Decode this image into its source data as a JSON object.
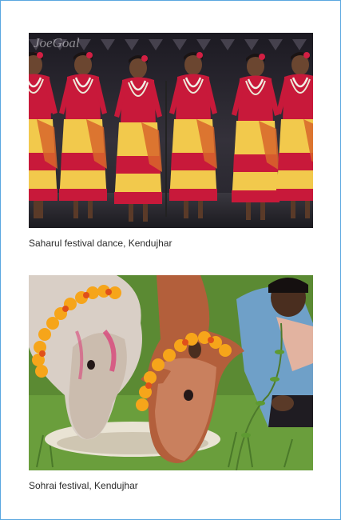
{
  "figures": [
    {
      "caption": "Saharul festival dance, Kendujhar",
      "watermark": "JoeGoal"
    },
    {
      "caption": "Sohrai festival, Kendujhar"
    }
  ],
  "colors": {
    "frame_border": "#5aa7e0",
    "dress_red": "#c8193a",
    "dress_yellow": "#f2c94c",
    "stage_dark": "#1e1c24",
    "marigold": "#f6a51a",
    "grass": "#4e7a2c"
  }
}
